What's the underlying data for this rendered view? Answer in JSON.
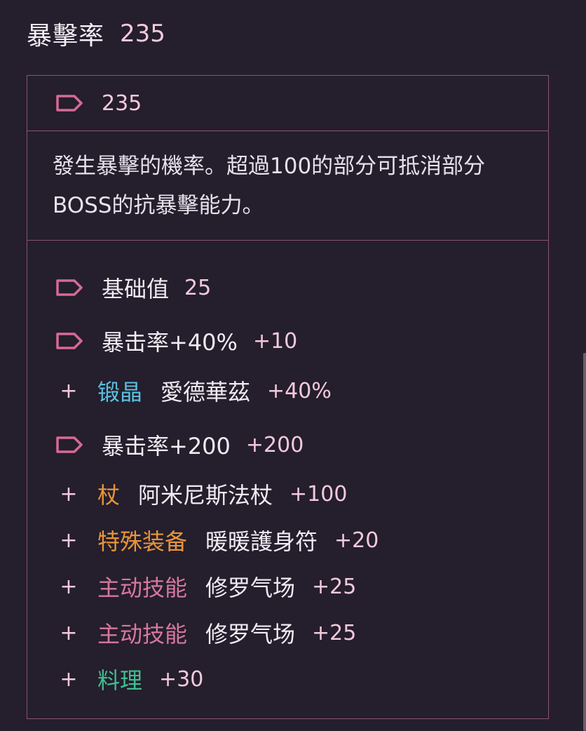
{
  "header": {
    "title": "暴擊率",
    "value": "235"
  },
  "panel": {
    "total": "235",
    "description": "發生暴擊的機率。超過100的部分可抵消部分BOSS的抗暴擊能力。",
    "groups": [
      {
        "label": "基础值",
        "amount": "25",
        "items": []
      },
      {
        "label": "暴击率+40%",
        "amount": "+10",
        "items": [
          {
            "category": "锻晶",
            "category_color": "#5bc0de",
            "name": "愛德華茲",
            "amount": "+40%"
          }
        ]
      },
      {
        "label": "暴击率+200",
        "amount": "+200",
        "items": [
          {
            "category": "杖",
            "category_color": "#e8953a",
            "name": "阿米尼斯法杖",
            "amount": "+100"
          },
          {
            "category": "特殊装备",
            "category_color": "#e8953a",
            "name": "暖暖護身符",
            "amount": "+20"
          },
          {
            "category": "主动技能",
            "category_color": "#d6789e",
            "name": "修罗气场",
            "amount": "+25"
          },
          {
            "category": "主动技能",
            "category_color": "#d6789e",
            "name": "修罗气场",
            "amount": "+25"
          },
          {
            "category": "料理",
            "category_color": "#3fbf8f",
            "name": "",
            "amount": "+30"
          }
        ]
      }
    ]
  },
  "colors": {
    "background": "#241e2d",
    "border": "#8a5570",
    "accent_pink": "#f3c9dc",
    "tag_icon": "#d66a95"
  }
}
